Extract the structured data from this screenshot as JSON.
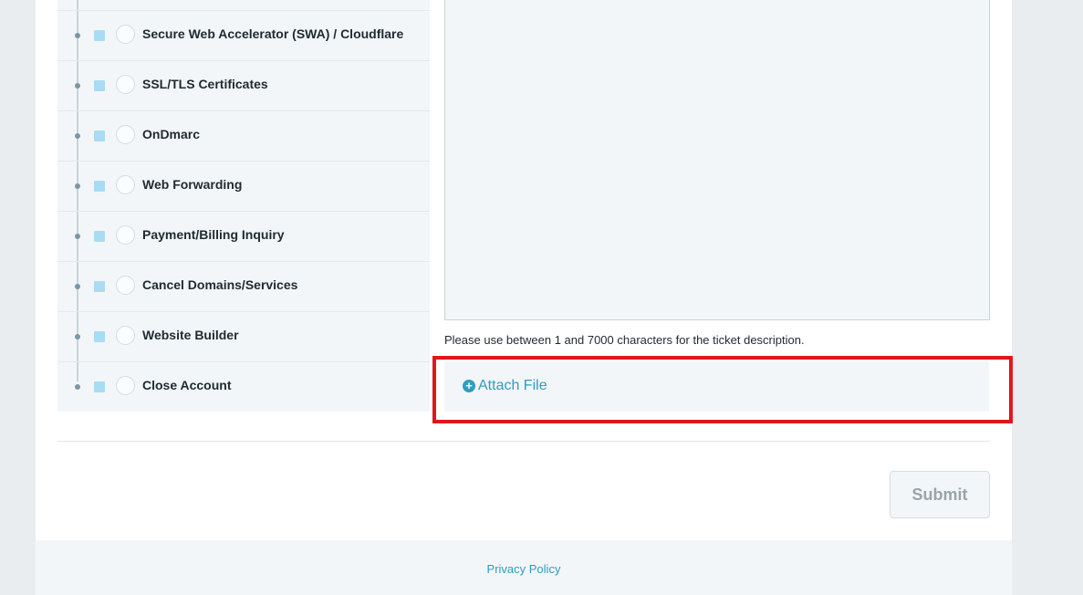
{
  "categories": [
    {
      "label": "Secure Web Accelerator (SWA) / Cloudflare"
    },
    {
      "label": "SSL/TLS Certificates"
    },
    {
      "label": "OnDmarc"
    },
    {
      "label": "Web Forwarding"
    },
    {
      "label": "Payment/Billing Inquiry"
    },
    {
      "label": "Cancel Domains/Services"
    },
    {
      "label": "Website Builder"
    },
    {
      "label": "Close Account"
    }
  ],
  "description": {
    "value": "",
    "hint": "Please use between 1 and 7000 characters for the ticket description."
  },
  "attach": {
    "icon": "plus-circle-icon",
    "label": "Attach File"
  },
  "submit_label": "Submit",
  "footer": {
    "privacy_label": "Privacy Policy"
  },
  "colors": {
    "accent": "#2e9dc2",
    "highlight": "#e0161b"
  }
}
